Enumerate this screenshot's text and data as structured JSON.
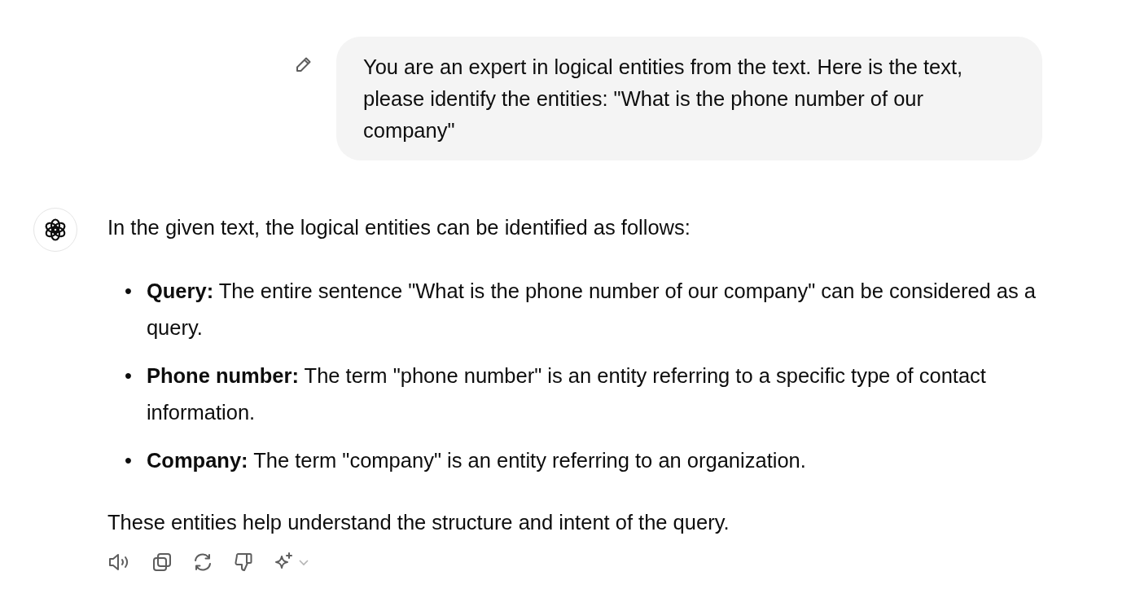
{
  "user_message": {
    "text": "You are an expert in logical entities from the text. Here is the text, please identify the entities: \"What is the phone number of our company\""
  },
  "assistant_message": {
    "intro": "In the given text, the logical entities can be identified as follows:",
    "bullets": [
      {
        "marker": "•",
        "text": "**Query:** The entire sentence \"What is the phone number of our company\" can be considered as a query."
      },
      {
        "marker": "•",
        "text": "**Phone number:** The term \"phone number\" is an entity referring to a specific type of contact information."
      },
      {
        "marker": "•",
        "text": "**Company:** The term \"company\" is an entity referring to an organization."
      }
    ],
    "closing": "These entities help understand the structure and intent of the query."
  }
}
